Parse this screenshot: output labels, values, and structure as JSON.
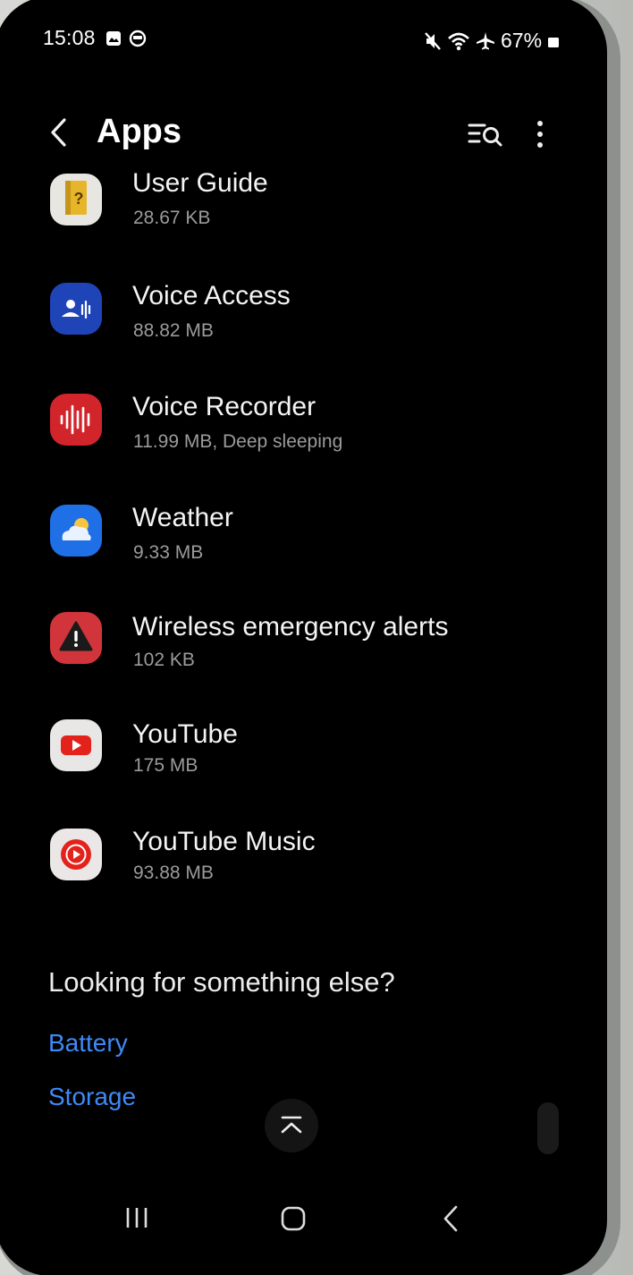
{
  "status_bar": {
    "time": "15:08",
    "battery_percent": "67%",
    "left_icons": [
      "gallery-icon",
      "sync-icon"
    ],
    "right_icons": [
      "mute-icon",
      "wifi-icon",
      "airplane-icon",
      "battery-icon"
    ]
  },
  "header": {
    "title": "Apps",
    "back_icon": "back-arrow-icon",
    "search_icon": "filter-search-icon",
    "more_icon": "more-vertical-icon"
  },
  "apps": [
    {
      "name": "User Guide",
      "subtitle": "28.67 KB",
      "icon": "user-guide-icon",
      "icon_bg": "#e8e6e1"
    },
    {
      "name": "Voice Access",
      "subtitle": "88.82 MB",
      "icon": "voice-access-icon",
      "icon_bg": "#1f44b8"
    },
    {
      "name": "Voice Recorder",
      "subtitle": "11.99 MB, Deep sleeping",
      "icon": "voice-recorder-icon",
      "icon_bg": "#d2252b"
    },
    {
      "name": "Weather",
      "subtitle": "9.33 MB",
      "icon": "weather-icon",
      "icon_bg": "#1f6fe6"
    },
    {
      "name": "Wireless emergency alerts",
      "subtitle": "102 KB",
      "icon": "warning-icon",
      "icon_bg": "#d1353b"
    },
    {
      "name": "YouTube",
      "subtitle": "175 MB",
      "icon": "youtube-icon",
      "icon_bg": "#e9e6e6"
    },
    {
      "name": "YouTube Music",
      "subtitle": "93.88 MB",
      "icon": "youtube-music-icon",
      "icon_bg": "#ebe7e7"
    }
  ],
  "footer": {
    "heading": "Looking for something else?",
    "links": [
      "Battery",
      "Storage"
    ],
    "link_color": "#3e8af7"
  },
  "controls": {
    "scroll_to_top_icon": "scroll-to-top-icon",
    "scroll_handle": "scrollbar-handle"
  },
  "nav_bar": {
    "recents_icon": "recents-icon",
    "home_icon": "home-icon",
    "back_icon": "back-icon"
  }
}
